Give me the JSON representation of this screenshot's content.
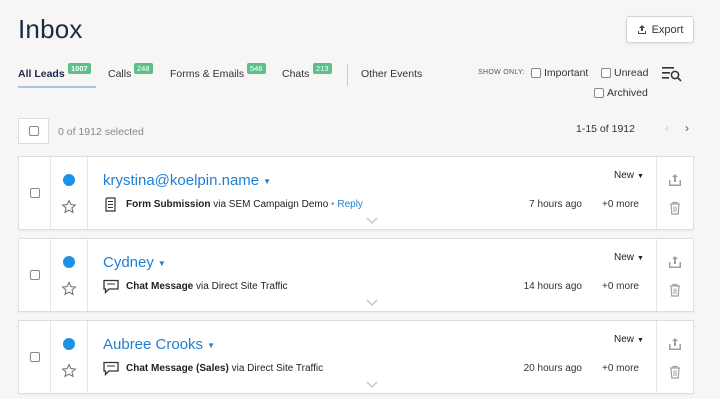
{
  "header": {
    "title": "Inbox",
    "export_label": "Export"
  },
  "tabs": [
    {
      "label": "All Leads",
      "count": "1007"
    },
    {
      "label": "Calls",
      "count": "248"
    },
    {
      "label": "Forms & Emails",
      "count": "546"
    },
    {
      "label": "Chats",
      "count": "213"
    },
    {
      "label": "Other Events",
      "count": ""
    }
  ],
  "filters": {
    "show_only_label": "SHOW ONLY:",
    "important": "Important",
    "unread": "Unread",
    "archived": "Archived"
  },
  "selection": {
    "selected_text": "0 of 1912 selected",
    "pagination_text": "1-15 of 1912"
  },
  "leads": [
    {
      "name": "krystina@koelpin.name",
      "type": "Form Submission",
      "via": "via SEM Campaign Demo",
      "reply_sep": " • ",
      "reply": "Reply",
      "time": "7 hours ago",
      "more": "+0 more",
      "status": "New",
      "icon": "form-icon"
    },
    {
      "name": "Cydney",
      "type": "Chat Message",
      "via": "via Direct Site Traffic",
      "reply_sep": "",
      "reply": "",
      "time": "14 hours ago",
      "more": "+0 more",
      "status": "New",
      "icon": "chat-icon"
    },
    {
      "name": "Aubree Crooks",
      "type": "Chat Message (Sales)",
      "via": "via Direct Site Traffic",
      "reply_sep": "",
      "reply": "",
      "time": "20 hours ago",
      "more": "+0 more",
      "status": "New",
      "icon": "chat-icon"
    }
  ],
  "colors": {
    "accent": "#1e7fd6",
    "badge": "#5cc08c",
    "unread_dot": "#1e90e6"
  }
}
